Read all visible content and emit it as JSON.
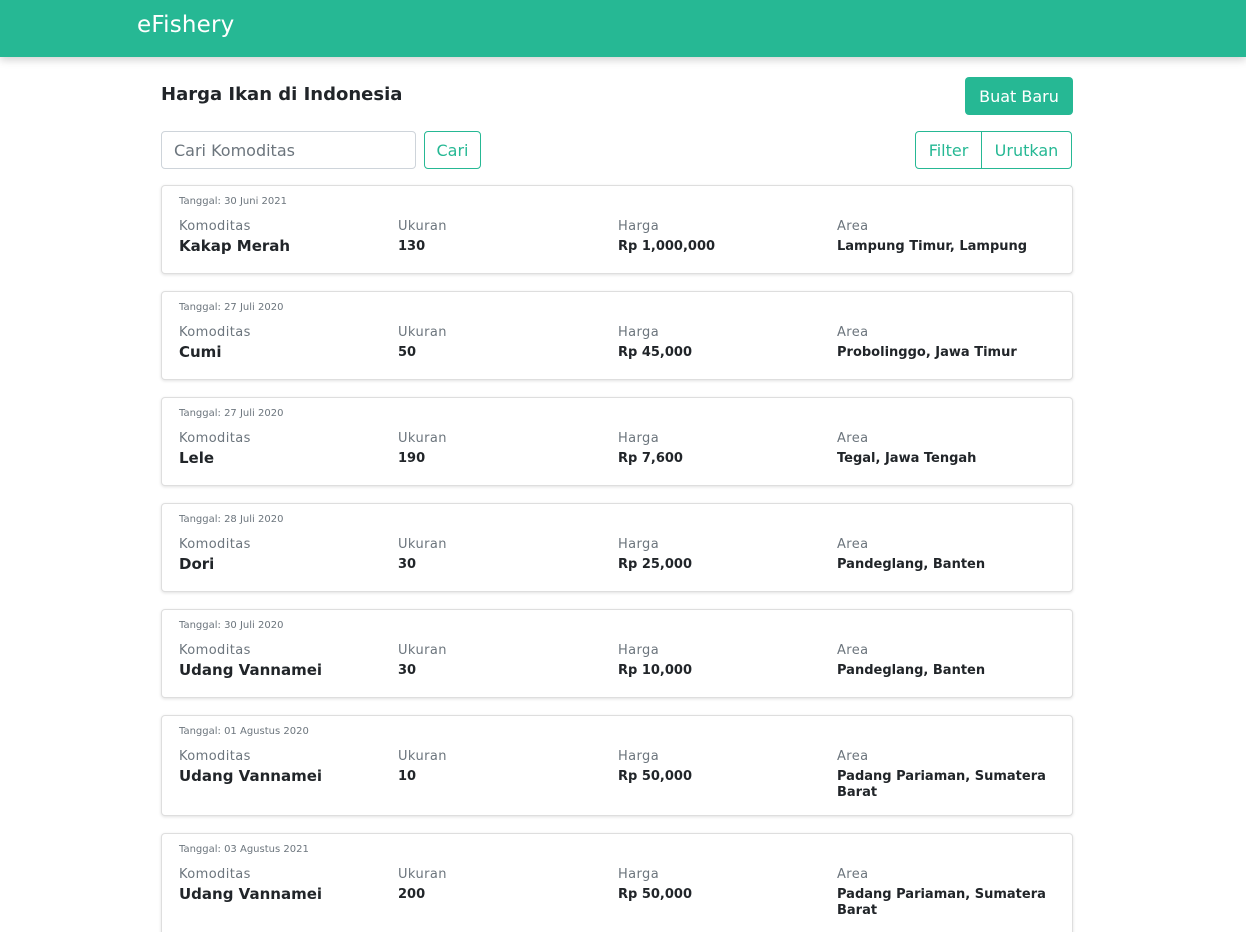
{
  "navbar": {
    "brand": "eFishery"
  },
  "header": {
    "title": "Harga Ikan di Indonesia",
    "create_button": "Buat Baru"
  },
  "search": {
    "placeholder": "Cari Komoditas",
    "value": "",
    "button": "Cari"
  },
  "controls": {
    "filter": "Filter",
    "sort": "Urutkan"
  },
  "labels": {
    "komoditas": "Komoditas",
    "ukuran": "Ukuran",
    "harga": "Harga",
    "area": "Area"
  },
  "items": [
    {
      "date": "Tanggal: 30 Juni 2021",
      "komoditas": "Kakap Merah",
      "ukuran": "130",
      "harga": "Rp 1,000,000",
      "area": "Lampung Timur, Lampung"
    },
    {
      "date": "Tanggal: 27 Juli 2020",
      "komoditas": "Cumi",
      "ukuran": "50",
      "harga": "Rp 45,000",
      "area": "Probolinggo, Jawa Timur"
    },
    {
      "date": "Tanggal: 27 Juli 2020",
      "komoditas": "Lele",
      "ukuran": "190",
      "harga": "Rp 7,600",
      "area": "Tegal, Jawa Tengah"
    },
    {
      "date": "Tanggal: 28 Juli 2020",
      "komoditas": "Dori",
      "ukuran": "30",
      "harga": "Rp 25,000",
      "area": "Pandeglang, Banten"
    },
    {
      "date": "Tanggal: 30 Juli 2020",
      "komoditas": "Udang Vannamei",
      "ukuran": "30",
      "harga": "Rp 10,000",
      "area": "Pandeglang, Banten"
    },
    {
      "date": "Tanggal: 01 Agustus 2020",
      "komoditas": "Udang Vannamei",
      "ukuran": "10",
      "harga": "Rp 50,000",
      "area": "Padang Pariaman, Sumatera Barat"
    },
    {
      "date": "Tanggal: 03 Agustus 2021",
      "komoditas": "Udang Vannamei",
      "ukuran": "200",
      "harga": "Rp 50,000",
      "area": "Padang Pariaman, Sumatera Barat"
    }
  ],
  "colors": {
    "brand": "#26b894",
    "text": "#212529",
    "muted": "#6c757d"
  }
}
